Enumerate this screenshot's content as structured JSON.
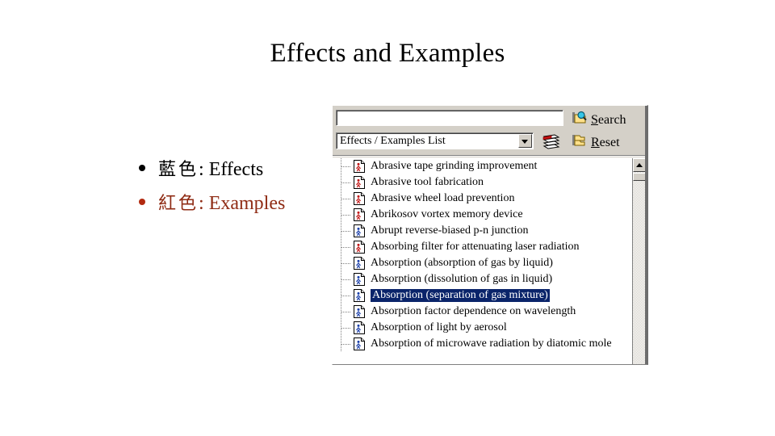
{
  "slide": {
    "title": "Effects and Examples",
    "bullets": [
      {
        "cjk": "藍色",
        "sep": ": ",
        "label": "Effects",
        "color": "#000000",
        "dot_color": "#000000"
      },
      {
        "cjk": "紅色",
        "sep": ": ",
        "label": "Examples",
        "color": "#8f2b14",
        "dot_color": "#b22a10"
      }
    ]
  },
  "app": {
    "search": {
      "value": "",
      "placeholder": ""
    },
    "combo": {
      "selected": "Effects / Examples List"
    },
    "buttons": {
      "search": {
        "label": "Search",
        "accel": "S",
        "icon": "search-folder-icon"
      },
      "reset": {
        "label": "Reset",
        "accel": "R",
        "icon": "folder-icon"
      },
      "books": {
        "icon": "books-stack-icon"
      }
    },
    "list": {
      "selected_index": 8,
      "items": [
        {
          "label": "Abrasive tape grinding improvement",
          "kind": "example"
        },
        {
          "label": "Abrasive tool fabrication",
          "kind": "example"
        },
        {
          "label": "Abrasive wheel load prevention",
          "kind": "example"
        },
        {
          "label": "Abrikosov vortex memory device",
          "kind": "example"
        },
        {
          "label": "Abrupt reverse-biased p-n junction",
          "kind": "effect"
        },
        {
          "label": "Absorbing filter for attenuating laser radiation",
          "kind": "example"
        },
        {
          "label": "Absorption (absorption of gas by liquid)",
          "kind": "effect"
        },
        {
          "label": "Absorption (dissolution of gas in liquid)",
          "kind": "effect"
        },
        {
          "label": "Absorption (separation of gas mixture)",
          "kind": "effect"
        },
        {
          "label": "Absorption factor dependence on wavelength",
          "kind": "effect"
        },
        {
          "label": "Absorption of light by aerosol",
          "kind": "effect"
        },
        {
          "label": "Absorption of microwave radiation by diatomic mole",
          "kind": "effect"
        }
      ]
    },
    "colors": {
      "example_icon": "#c01414",
      "effect_icon": "#1a3faa",
      "selection_bg": "#0a246a",
      "selection_fg": "#ffffff",
      "window_face": "#d4d0c8"
    }
  }
}
